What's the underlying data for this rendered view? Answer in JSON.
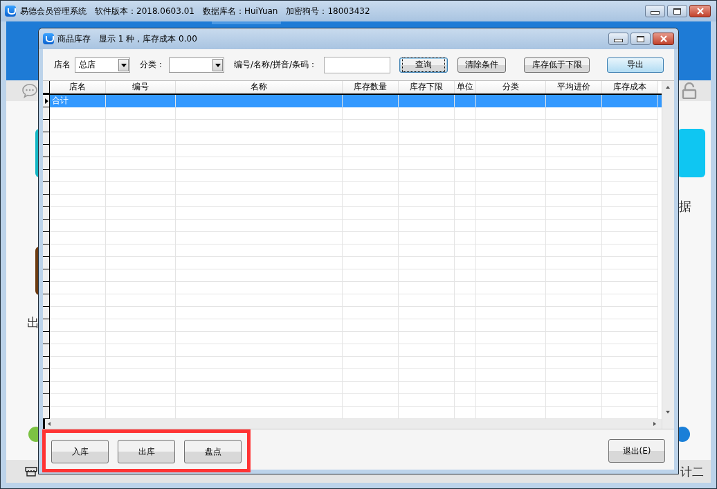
{
  "window": {
    "title_parts": [
      "易德会员管理系统",
      "软件版本：2018.0603.01",
      "数据库名：HuiYuan",
      "加密狗号：18003432"
    ]
  },
  "background": {
    "labels": [
      {
        "kind": "left-bottom",
        "text": "出"
      },
      {
        "kind": "right-top",
        "text": "据"
      },
      {
        "kind": "status",
        "text": "计二"
      }
    ]
  },
  "dialog": {
    "title": "商品库存",
    "summary": "显示 1 种，库存成本 0.00",
    "filters": [
      {
        "kind": "select",
        "label": "店名",
        "value": "总店"
      },
      {
        "kind": "select",
        "label": "分类："
      },
      {
        "kind": "input",
        "label": "编号/名称/拼音/条码："
      }
    ],
    "buttons": [
      {
        "label": "查询",
        "focused": true,
        "default": false
      },
      {
        "label": "清除条件",
        "focused": false,
        "default": false
      },
      {
        "label": "库存低于下限",
        "focused": false,
        "default": false
      },
      {
        "label": "导出",
        "focused": false,
        "default": true
      }
    ],
    "table": {
      "columns": [
        "店名",
        "编号",
        "名称",
        "库存数量",
        "库存下限",
        "单位",
        "分类",
        "平均进价",
        "库存成本"
      ],
      "rows": [
        {
          "selected": true,
          "cells": [
            "合计"
          ]
        }
      ]
    },
    "action_group": {
      "highlighted": true,
      "buttons": [
        "入库",
        "出库",
        "盘点"
      ]
    },
    "exit_button": {
      "label": "退出(E)"
    }
  }
}
